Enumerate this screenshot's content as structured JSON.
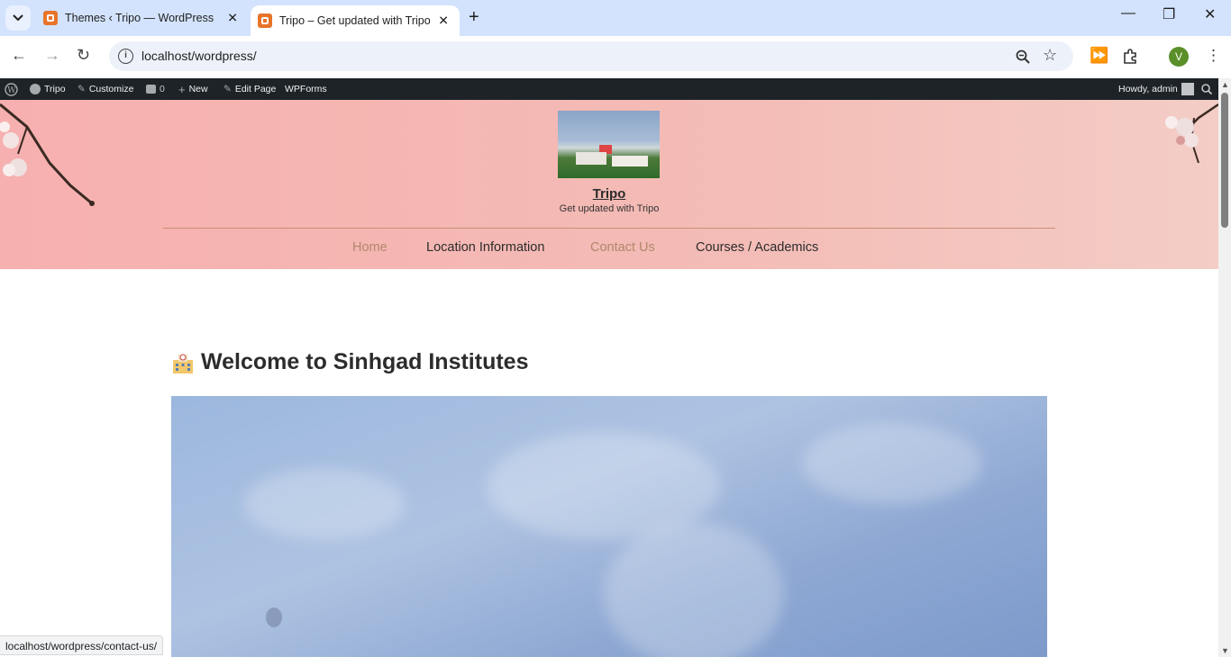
{
  "browser": {
    "tabs": [
      {
        "title": "Themes ‹ Tripo — WordPress",
        "active": false
      },
      {
        "title": "Tripo – Get updated with Tripo",
        "active": true
      }
    ],
    "url": "localhost/wordpress/",
    "profile_initial": "V",
    "status_url": "localhost/wordpress/contact-us/"
  },
  "adminbar": {
    "site": "Tripo",
    "customize": "Customize",
    "comments": "0",
    "new": "New",
    "edit": "Edit Page",
    "wpforms": "WPForms",
    "howdy": "Howdy, admin"
  },
  "site": {
    "title": "Tripo",
    "tagline": "Get updated with Tripo",
    "menu": [
      {
        "label": "Home",
        "color": "#b0876a"
      },
      {
        "label": "Location Information",
        "color": "#2c2c2c"
      },
      {
        "label": "Contact Us",
        "color": "#b0876a"
      },
      {
        "label": "Courses / Academics",
        "color": "#2c2c2c"
      }
    ]
  },
  "content": {
    "welcome_prefix": "Welcome to",
    "welcome_name": "Sinhgad Institutes"
  },
  "colors": {
    "header_pink": "#f6b0af",
    "adminbar": "#1d2327",
    "menu_accent": "#b0876a"
  }
}
